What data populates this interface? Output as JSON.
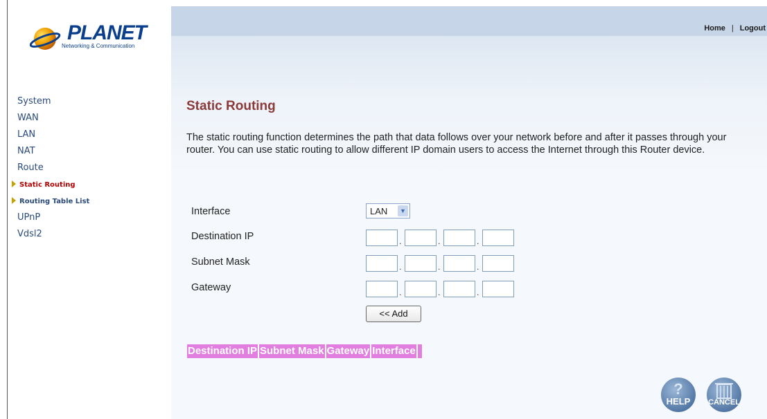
{
  "brand": {
    "name": "PLANET",
    "tagline": "Networking & Communication"
  },
  "header": {
    "home_label": "Home",
    "separator": "|",
    "logout_label": "Logout"
  },
  "sidebar": {
    "items": [
      {
        "label": "System"
      },
      {
        "label": "WAN"
      },
      {
        "label": "LAN"
      },
      {
        "label": "NAT"
      },
      {
        "label": "Route"
      }
    ],
    "route_sub": [
      {
        "label": "Static Routing",
        "active": true
      },
      {
        "label": "Routing Table List",
        "active": false
      }
    ],
    "items_after": [
      {
        "label": "UPnP"
      },
      {
        "label": "Vdsl2"
      }
    ]
  },
  "main": {
    "title": "Static Routing",
    "description": "The static routing function determines the path that data follows over your network before and after it passes through your router. You can use static routing to allow different IP domain users to access the Internet through this Router device.",
    "form": {
      "interface_label": "Interface",
      "interface_value": "LAN",
      "destination_label": "Destination IP",
      "subnet_label": "Subnet Mask",
      "gateway_label": "Gateway",
      "add_label": "<< Add"
    },
    "table_headers": [
      "Destination IP",
      "Subnet Mask",
      "Gateway",
      "Interface"
    ],
    "help_label": "HELP",
    "cancel_label": "CANCEL"
  },
  "colors": {
    "title": "#8b3a3a",
    "nav_active": "#b30000",
    "table_header_bg": "#e17ee0",
    "top_bar": "#c6d6e8"
  },
  "icons": [
    "planet-logo-icon",
    "chevron-down-icon",
    "arrow-right-icon",
    "help-icon",
    "cancel-icon"
  ]
}
